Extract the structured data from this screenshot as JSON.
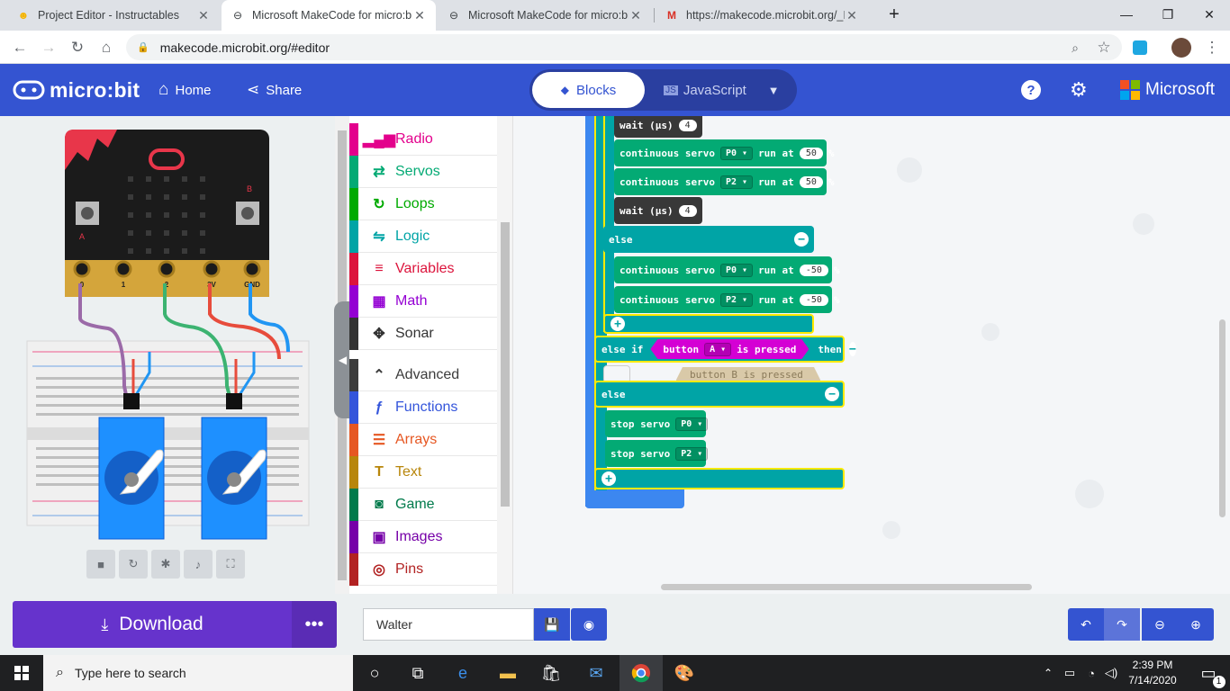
{
  "browser": {
    "tabs": [
      {
        "title": "Project Editor - Instructables",
        "active": false
      },
      {
        "title": "Microsoft MakeCode for micro:bi",
        "active": true
      },
      {
        "title": "Microsoft MakeCode for micro:bi",
        "active": false
      },
      {
        "title": "https://makecode.microbit.org/_I",
        "active": false
      }
    ],
    "url": "makecode.microbit.org/#editor"
  },
  "header": {
    "logo": "micro:bit",
    "home_label": "Home",
    "share_label": "Share",
    "blocks_label": "Blocks",
    "javascript_label": "JavaScript",
    "microsoft_label": "Microsoft"
  },
  "simulator": {
    "pins": [
      "0",
      "1",
      "2",
      "3V",
      "GND"
    ],
    "button_a": "A",
    "button_b": "B",
    "controls": [
      "stop-icon",
      "restart-icon",
      "debug-icon",
      "mute-icon",
      "fullscreen-icon"
    ]
  },
  "toolbox": {
    "categories": [
      {
        "label": "Radio",
        "color": "#e3008c",
        "icon": "radio-icon",
        "glyph": "▂▄▆"
      },
      {
        "label": "Servos",
        "color": "#03aa74",
        "icon": "servos-icon",
        "glyph": "⇄"
      },
      {
        "label": "Loops",
        "color": "#00aa00",
        "icon": "loops-icon",
        "glyph": "↻"
      },
      {
        "label": "Logic",
        "color": "#00a4a6",
        "icon": "logic-icon",
        "glyph": "⇋"
      },
      {
        "label": "Variables",
        "color": "#dc143c",
        "icon": "variables-icon",
        "glyph": "≡"
      },
      {
        "label": "Math",
        "color": "#9400d3",
        "icon": "math-icon",
        "glyph": "▦"
      },
      {
        "label": "Sonar",
        "color": "#333333",
        "icon": "sonar-icon",
        "glyph": "✥"
      },
      {
        "label": "Advanced",
        "color": "#3c3c3c",
        "icon": "advanced-icon",
        "glyph": "⌃"
      },
      {
        "label": "Functions",
        "color": "#3455db",
        "icon": "functions-icon",
        "glyph": "ƒ"
      },
      {
        "label": "Arrays",
        "color": "#e65722",
        "icon": "arrays-icon",
        "glyph": "☰"
      },
      {
        "label": "Text",
        "color": "#b8860b",
        "icon": "text-icon",
        "glyph": "T"
      },
      {
        "label": "Game",
        "color": "#007a4b",
        "icon": "game-icon",
        "glyph": "◙"
      },
      {
        "label": "Images",
        "color": "#7600a8",
        "icon": "images-icon",
        "glyph": "▣"
      },
      {
        "label": "Pins",
        "color": "#b22222",
        "icon": "pins-icon",
        "glyph": "◎"
      }
    ]
  },
  "workspace": {
    "wait1": {
      "label": "wait (µs)",
      "value": "4"
    },
    "cs1": {
      "label": "continuous servo",
      "pin": "P0",
      "run": "run at",
      "value": "50",
      "unit": "%"
    },
    "cs2": {
      "label": "continuous servo",
      "pin": "P2",
      "run": "run at",
      "value": "50",
      "unit": "%"
    },
    "wait2": {
      "label": "wait (µs)",
      "value": "4"
    },
    "else1": "else",
    "cs3": {
      "label": "continuous servo",
      "pin": "P0",
      "run": "run at",
      "value": "-50",
      "unit": "%"
    },
    "cs4": {
      "label": "continuous servo",
      "pin": "P2",
      "run": "run at",
      "value": "-50",
      "unit": "%"
    },
    "elseif": {
      "label": "else if",
      "cond": "button",
      "btn": "A",
      "pressed": "is pressed",
      "then": "then"
    },
    "ghost": "button  B  is pressed",
    "else2": "else",
    "stop1": {
      "label": "stop servo",
      "pin": "P0"
    },
    "stop2": {
      "label": "stop servo",
      "pin": "P2"
    }
  },
  "footer": {
    "download_label": "Download",
    "more_label": "•••",
    "project_name": "Walter"
  },
  "taskbar": {
    "search_placeholder": "Type here to search",
    "time": "2:39 PM",
    "date": "7/14/2020",
    "notifications": "1"
  }
}
